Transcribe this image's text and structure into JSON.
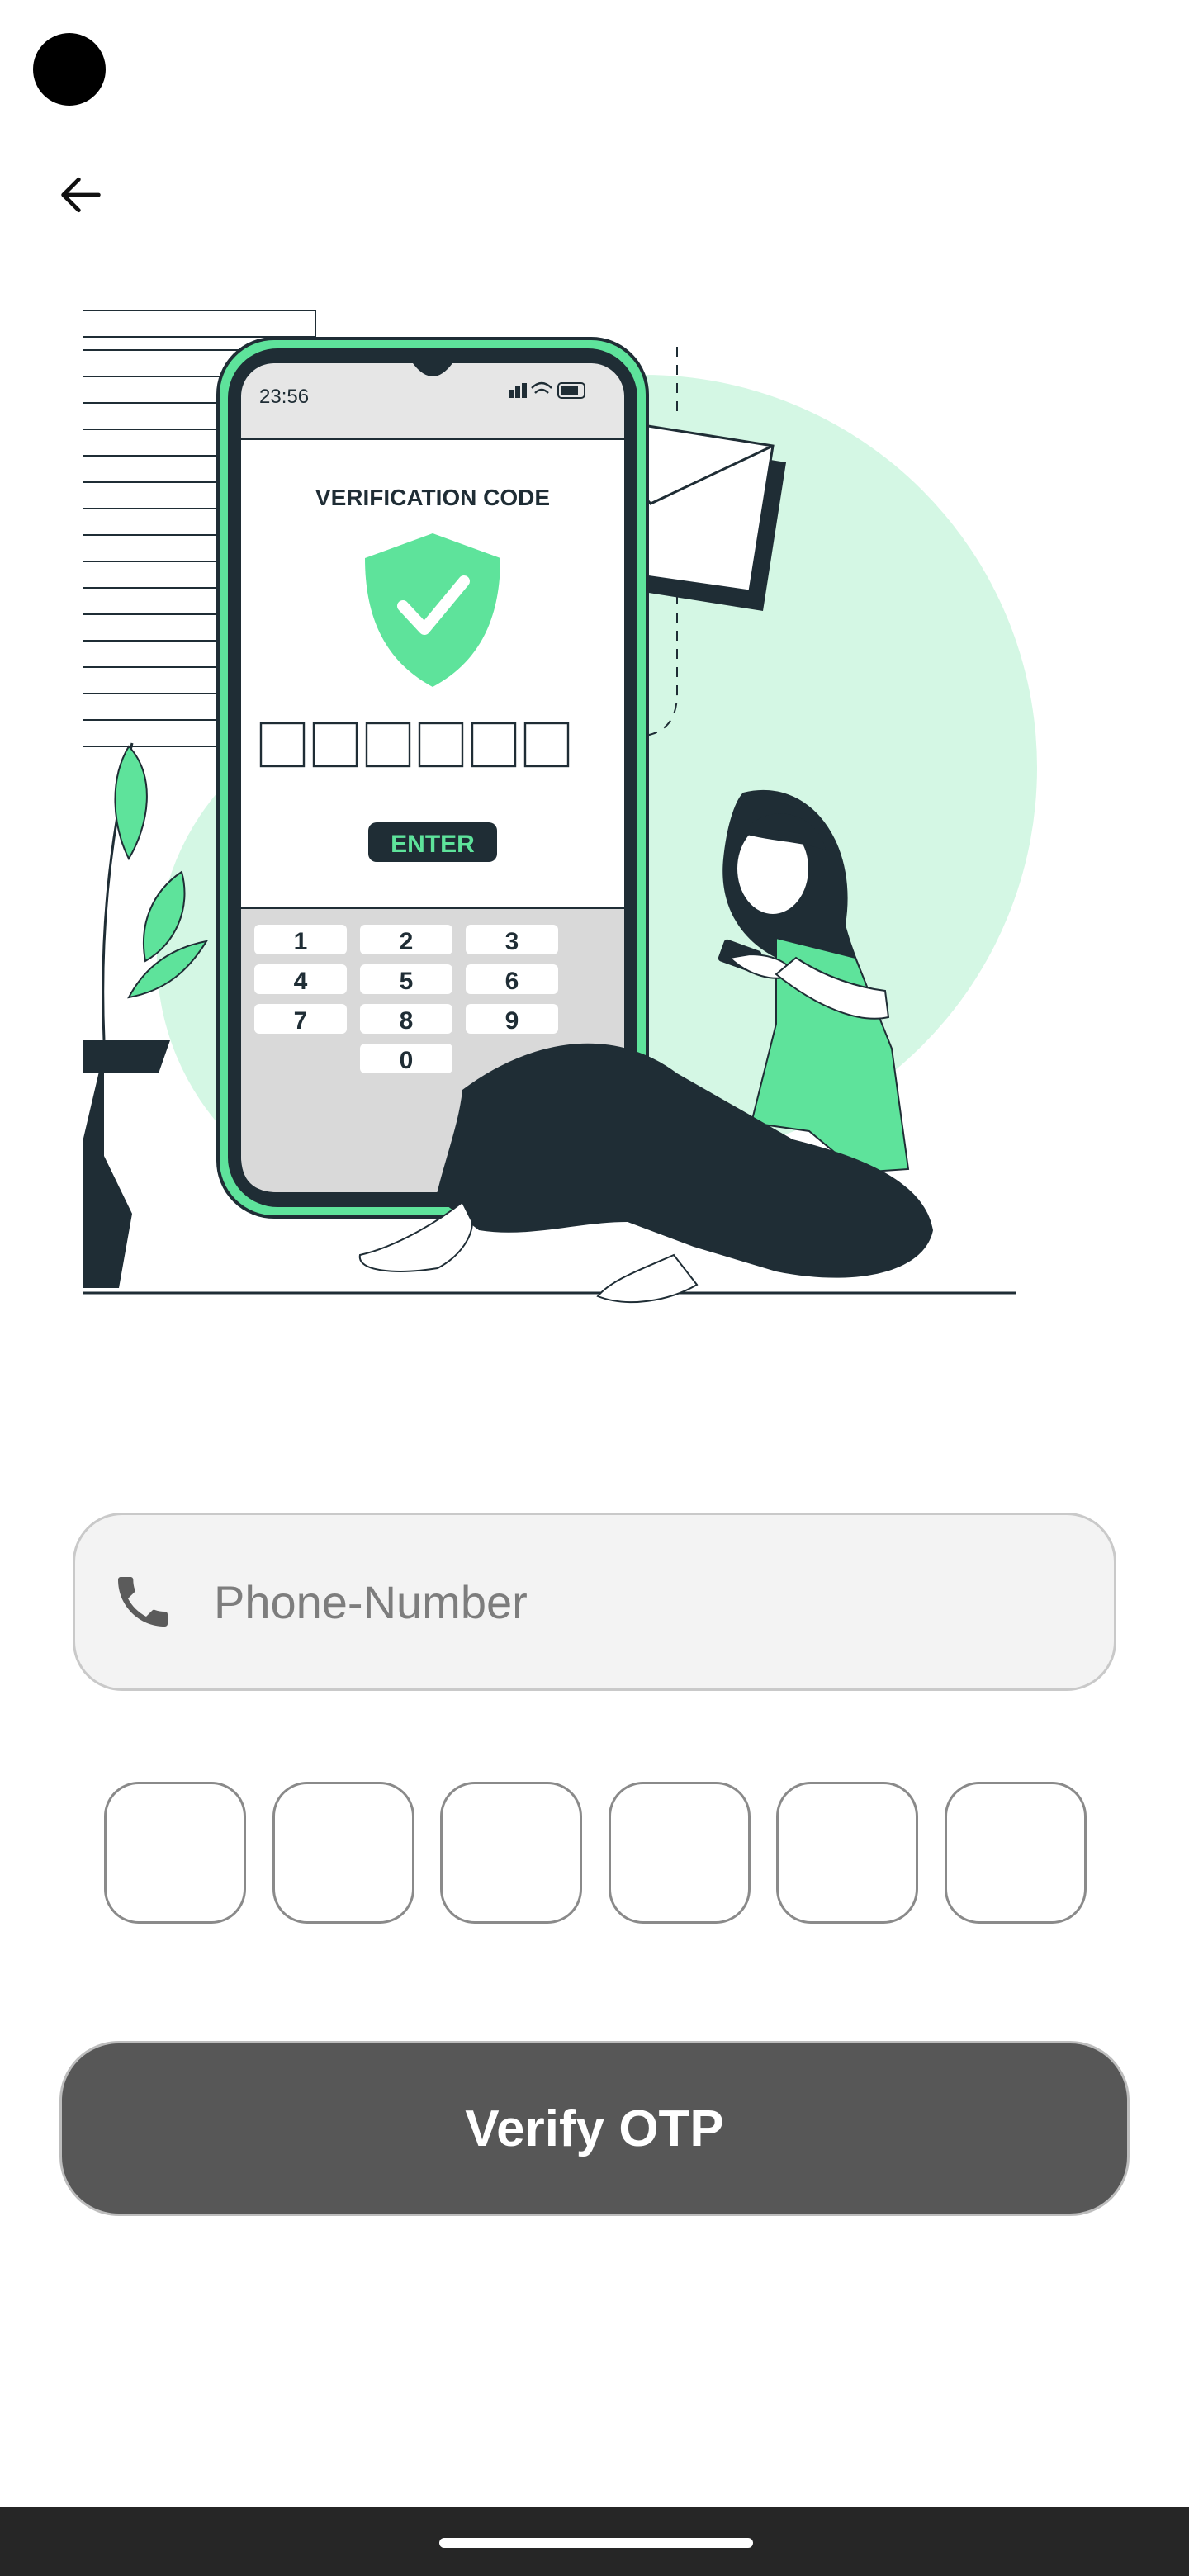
{
  "header": {
    "back_icon": "arrow-left-icon"
  },
  "illustration": {
    "phone_clock": "23:56",
    "screen_title": "VERIFICATION CODE",
    "enter_label": "ENTER",
    "keypad": [
      "1",
      "2",
      "3",
      "4",
      "5",
      "6",
      "7",
      "8",
      "9",
      "0"
    ],
    "colors": {
      "accent": "#5ee39b",
      "light_accent": "#d4f7e4",
      "dark": "#1f2d35"
    }
  },
  "form": {
    "phone_icon": "phone-icon",
    "phone_placeholder": "Phone-Number",
    "phone_value": "",
    "otp_digits": [
      "",
      "",
      "",
      "",
      "",
      ""
    ]
  },
  "actions": {
    "verify_label": "Verify OTP"
  },
  "colors": {
    "button_bg": "#575757",
    "field_bg": "#f3f3f3",
    "nav_bar": "#262626"
  }
}
